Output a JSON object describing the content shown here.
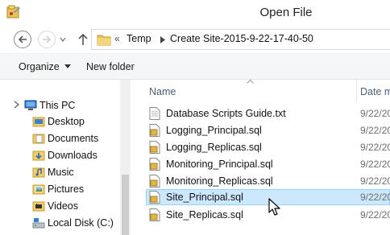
{
  "window": {
    "title": "Open File"
  },
  "address_bar": {
    "overflow": "«",
    "crumbs": [
      "Temp",
      "Create Site-2015-9-22-17-40-50"
    ]
  },
  "toolbar": {
    "organize_label": "Organize",
    "new_folder_label": "New folder"
  },
  "nav_pane": {
    "items": [
      {
        "label": "This PC",
        "icon": "computer-icon"
      },
      {
        "label": "Desktop",
        "icon": "folder-icon"
      },
      {
        "label": "Documents",
        "icon": "documents-folder-icon"
      },
      {
        "label": "Downloads",
        "icon": "downloads-folder-icon"
      },
      {
        "label": "Music",
        "icon": "music-folder-icon"
      },
      {
        "label": "Pictures",
        "icon": "pictures-folder-icon"
      },
      {
        "label": "Videos",
        "icon": "videos-folder-icon"
      },
      {
        "label": "Local Disk (C:)",
        "icon": "drive-icon"
      }
    ]
  },
  "file_list": {
    "columns": [
      "Name",
      "Date m"
    ],
    "files": [
      {
        "name": "Database Scripts Guide.txt",
        "date": "9/22/20",
        "icon": "text-file-icon",
        "selected": false
      },
      {
        "name": "Logging_Principal.sql",
        "date": "9/22/20",
        "icon": "sql-file-icon",
        "selected": false
      },
      {
        "name": "Logging_Replicas.sql",
        "date": "9/22/20",
        "icon": "sql-file-icon",
        "selected": false
      },
      {
        "name": "Monitoring_Principal.sql",
        "date": "9/22/20",
        "icon": "sql-file-icon",
        "selected": false
      },
      {
        "name": "Monitoring_Replicas.sql",
        "date": "9/22/20",
        "icon": "sql-file-icon",
        "selected": false
      },
      {
        "name": "Site_Principal.sql",
        "date": "9/22/20",
        "icon": "sql-file-icon",
        "selected": true
      },
      {
        "name": "Site_Replicas.sql",
        "date": "9/22/20",
        "icon": "sql-file-icon",
        "selected": false
      }
    ]
  },
  "colors": {
    "selection_bg": "#cce8ff",
    "selection_border": "#99d1ff",
    "column_header_text": "#4c607a",
    "toolbar_bg": "#f5f6f7"
  }
}
